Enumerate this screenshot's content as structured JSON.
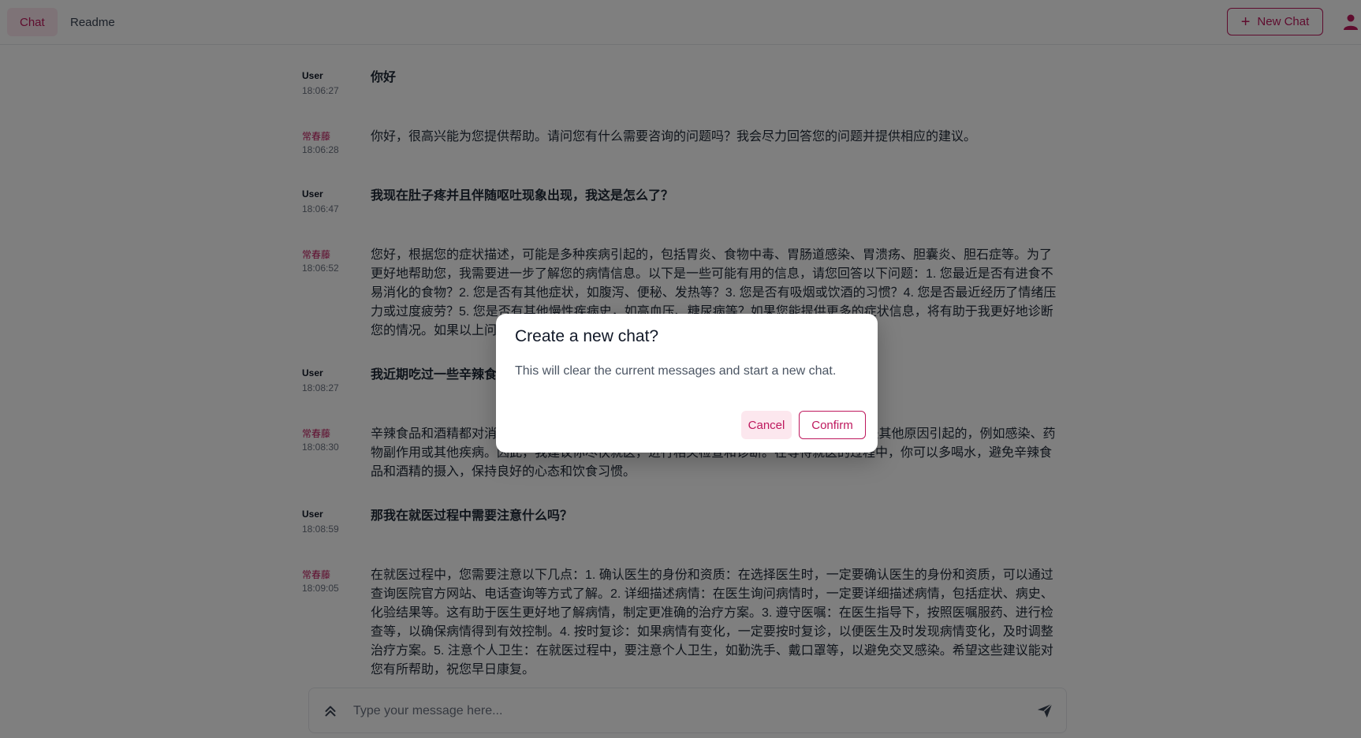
{
  "nav": {
    "tabs": [
      {
        "label": "Chat"
      },
      {
        "label": "Readme"
      }
    ],
    "new_chat_label": "New Chat"
  },
  "messages": [
    {
      "role": "user",
      "author": "User",
      "time": "18:06:27",
      "text": "你好"
    },
    {
      "role": "bot",
      "author": "常春藤",
      "time": "18:06:28",
      "text": "你好，很高兴能为您提供帮助。请问您有什么需要咨询的问题吗？我会尽力回答您的问题并提供相应的建议。"
    },
    {
      "role": "user",
      "author": "User",
      "time": "18:06:47",
      "text": "我现在肚子疼并且伴随呕吐现象出现，我这是怎么了？"
    },
    {
      "role": "bot",
      "author": "常春藤",
      "time": "18:06:52",
      "text": "您好，根据您的症状描述，可能是多种疾病引起的，包括胃炎、食物中毒、胃肠道感染、胃溃疡、胆囊炎、胆石症等。为了更好地帮助您，我需要进一步了解您的病情信息。以下是一些可能有用的信息，请您回答以下问题：1. 您最近是否有进食不易消化的食物？2. 您是否有其他症状，如腹泻、便秘、发热等？3. 您是否有吸烟或饮酒的习惯？4. 您是否最近经历了情绪压力或过度疲劳？5. 您是否有其他慢性疾病史，如高血压、糖尿病等？如果您能提供更多的症状信息，将有助于我更好地诊断您的情况。如果以上问"
    },
    {
      "role": "user",
      "author": "User",
      "time": "18:08:27",
      "text": "我近期吃过一些辛辣食"
    },
    {
      "role": "bot",
      "author": "常春藤",
      "time": "18:08:30",
      "text": "辛辣食品和酒精都对消                                                                              恶心、呕吐等症状，可能与这些因素有关。但是，这些症状也可能是其他原因引起的，例如感染、药物副作用或其他疾病。因此，我建议你尽快就医，进行相关检查和诊断。在等待就医的过程中，你可以多喝水，避免辛辣食品和酒精的摄入，保持良好的心态和饮食习惯。"
    },
    {
      "role": "user",
      "author": "User",
      "time": "18:08:59",
      "text": "那我在就医过程中需要注意什么吗？"
    },
    {
      "role": "bot",
      "author": "常春藤",
      "time": "18:09:05",
      "text": "在就医过程中，您需要注意以下几点：1. 确认医生的身份和资质：在选择医生时，一定要确认医生的身份和资质，可以通过查询医院官方网站、电话查询等方式了解。2. 详细描述病情：在医生询问病情时，一定要详细描述病情，包括症状、病史、化验结果等。这有助于医生更好地了解病情，制定更准确的治疗方案。3. 遵守医嘱：在医生指导下，按照医嘱服药、进行检查等，以确保病情得到有效控制。4. 按时复诊：如果病情有变化，一定要按时复诊，以便医生及时发现病情变化，及时调整治疗方案。5. 注意个人卫生：在就医过程中，要注意个人卫生，如勤洗手、戴口罩等，以避免交叉感染。希望这些建议能对您有所帮助，祝您早日康复。"
    }
  ],
  "input": {
    "placeholder": "Type your message here..."
  },
  "dialog": {
    "title": "Create a new chat?",
    "description": "This will clear the current messages and start a new chat.",
    "cancel_label": "Cancel",
    "confirm_label": "Confirm"
  },
  "colors": {
    "accent": "#be185d",
    "accent_soft": "#fce7ee",
    "overlay": "rgba(0,0,0,0.5)"
  },
  "icons": {
    "new_chat": "plus-icon",
    "profile": "user-icon",
    "expand": "chevron-double-up-icon",
    "send": "send-icon"
  }
}
